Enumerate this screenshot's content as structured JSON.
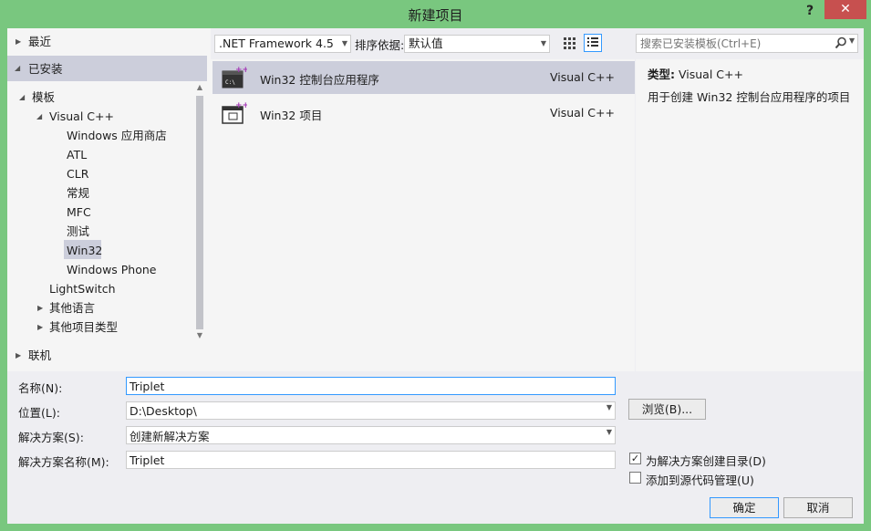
{
  "window": {
    "title": "新建项目",
    "help": "?",
    "close": "✕"
  },
  "tree": {
    "recent": "最近",
    "installed": "已安装",
    "templates": "模板",
    "visual_cpp": "Visual C++",
    "items": [
      "Windows 应用商店",
      "ATL",
      "CLR",
      "常规",
      "MFC",
      "测试",
      "Win32",
      "Windows Phone"
    ],
    "lightswitch": "LightSwitch",
    "other_languages": "其他语言",
    "other_project_types": "其他项目类型",
    "online": "联机"
  },
  "toolbar": {
    "framework": ".NET Framework 4.5",
    "sort_label": "排序依据:",
    "sort_value": "默认值"
  },
  "search": {
    "placeholder": "搜索已安装模板(Ctrl+E)"
  },
  "templates": [
    {
      "name": "Win32 控制台应用程序",
      "lang": "Visual C++",
      "selected": true
    },
    {
      "name": "Win32 项目",
      "lang": "Visual C++",
      "selected": false
    }
  ],
  "description": {
    "type_label": "类型:",
    "type_value": "Visual C++",
    "text": "用于创建 Win32 控制台应用程序的项目"
  },
  "form": {
    "name_label": "名称(N):",
    "name_value": "Triplet",
    "location_label": "位置(L):",
    "location_value": "D:\\Desktop\\",
    "solution_label": "解决方案(S):",
    "solution_value": "创建新解决方案",
    "solution_name_label": "解决方案名称(M):",
    "solution_name_value": "Triplet",
    "browse": "浏览(B)...",
    "create_dir": "为解决方案创建目录(D)",
    "add_source_control": "添加到源代码管理(U)",
    "ok": "确定",
    "cancel": "取消"
  },
  "colors": {
    "frame": "#79c77f",
    "accent": "#3399ff",
    "selection": "#cccedb",
    "close": "#c7504f"
  }
}
